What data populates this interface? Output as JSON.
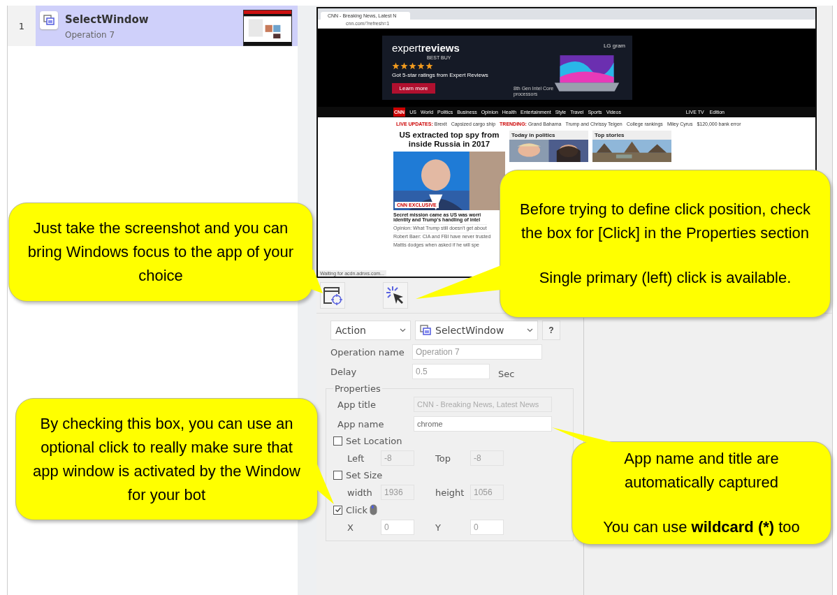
{
  "sequence": {
    "rows": [
      {
        "number": "1",
        "title": "SelectWindow",
        "subtitle": "Operation 7",
        "selected": true
      }
    ]
  },
  "preview": {
    "tab_title": "CNN - Breaking News, Latest N",
    "url": "cnn.com/?refresh=1",
    "ad": {
      "brand_light": "expert",
      "brand_bold": "reviews",
      "badge": "BEST BUY",
      "stars": 5,
      "tagline": "Got 5-star ratings from Expert Reviews",
      "button": "Learn more",
      "product": "LG gram",
      "chip": "8th Gen Intel Core processors"
    },
    "nav": {
      "logo": "CNN",
      "items": [
        "US",
        "World",
        "Politics",
        "Business",
        "Opinion",
        "Health",
        "Entertainment",
        "Style",
        "Travel",
        "Sports",
        "Videos"
      ],
      "live": "LIVE TV",
      "edition": "Edition"
    },
    "trending": [
      {
        "label": "LIVE UPDATES:",
        "text": "Brexit"
      },
      {
        "text": "Capsized cargo ship"
      },
      {
        "label": "TRENDING:",
        "text": "Grand Bahama"
      },
      {
        "text": "Trump and Chrissy Teigen"
      },
      {
        "text": "College rankings"
      },
      {
        "text": "Miley Cyrus"
      },
      {
        "text": "$120,000 bank error"
      }
    ],
    "headline": "US extracted top spy from inside Russia in 2017",
    "tag": "CNN EXCLUSIVE",
    "lead_lines": [
      "Secret mission came as US was worri",
      "identity and Trump's handling of intel"
    ],
    "links": [
      "Opinion: What Trump still doesn't get about",
      "Robert Baer: CIA and FBI have never trusted",
      "Mattis dodges when asked if he will spe"
    ],
    "boxes": [
      {
        "title": "Today in politics"
      },
      {
        "title": "Top stories"
      }
    ],
    "status": "Waiting for acdn.adnxs.com..."
  },
  "form": {
    "type_select": "Action",
    "command_select": "SelectWindow",
    "help": "?",
    "operation_label": "Operation name",
    "operation_value": "Operation 7",
    "delay_label": "Delay",
    "delay_value": "0.5",
    "delay_unit": "Sec"
  },
  "properties": {
    "legend": "Properties",
    "rows": [
      {
        "kind": "field",
        "label": "App title",
        "value": "CNN - Breaking News, Latest News",
        "disabled": true
      },
      {
        "kind": "field",
        "label": "App name",
        "value": "chrome",
        "disabled": false
      },
      {
        "kind": "check",
        "label": "Set Location",
        "checked": false,
        "mouse": false,
        "pair": [
          {
            "label": "Left",
            "value": "-8"
          },
          {
            "label": "Top",
            "value": "-8"
          }
        ]
      },
      {
        "kind": "check",
        "label": "Set Size",
        "checked": false,
        "mouse": false,
        "pair": [
          {
            "label": "width",
            "value": "1936"
          },
          {
            "label": "height",
            "value": "1056"
          }
        ]
      },
      {
        "kind": "check",
        "label": "Click",
        "checked": true,
        "mouse": true,
        "pair": [
          {
            "label": "X",
            "value": "0"
          },
          {
            "label": "Y",
            "value": "0"
          }
        ]
      }
    ]
  },
  "callouts": [
    {
      "paragraphs": [
        "Just take the screenshot and you can bring Windows focus to the app of your choice"
      ]
    },
    {
      "paragraphs": [
        "Before trying to define click position, check the box for  [Click] in the Properties section",
        "Single primary (left) click is available."
      ]
    },
    {
      "paragraphs": [
        "By checking this box, you can use an optional click to really make sure that app window is activated by the Window for your bot"
      ]
    },
    {
      "paragraphs": [
        "App name and title are automatically captured",
        "You can use **wildcard (*)** too"
      ]
    }
  ]
}
